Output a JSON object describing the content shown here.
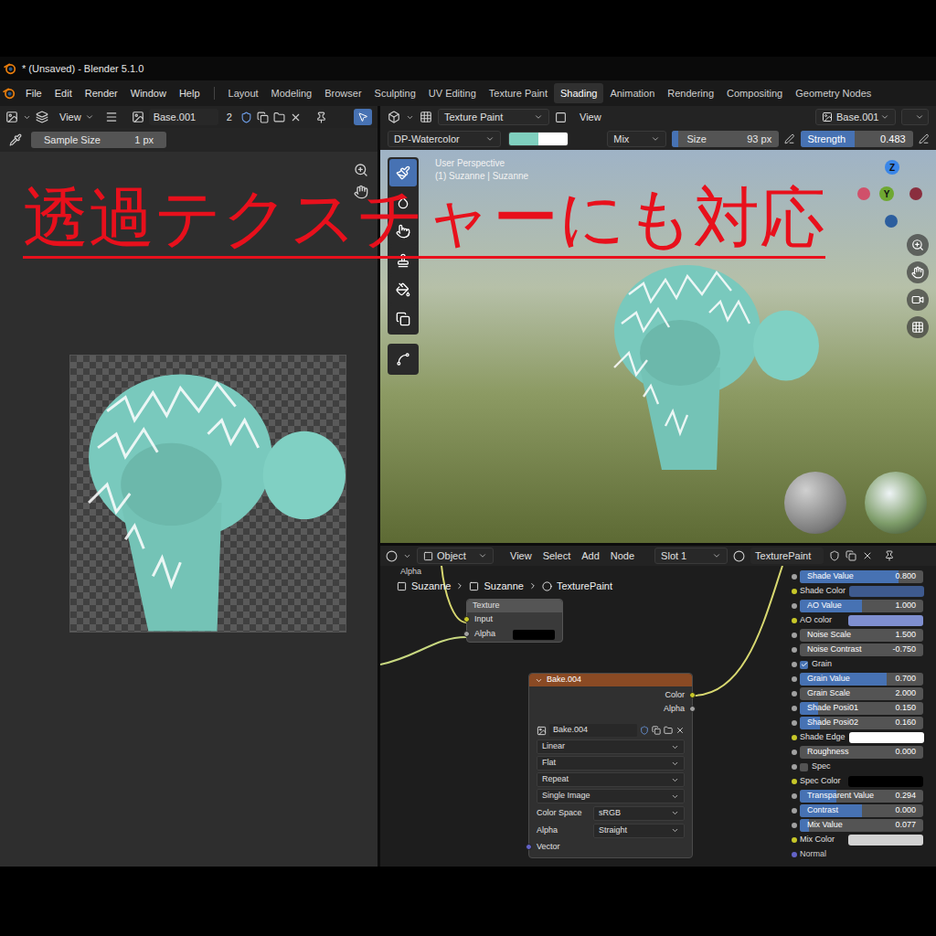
{
  "window": {
    "title": "* (Unsaved) - Blender 5.1.0"
  },
  "menus": [
    "File",
    "Edit",
    "Render",
    "Window",
    "Help"
  ],
  "workspaces": [
    {
      "label": "Layout",
      "selected": false
    },
    {
      "label": "Modeling",
      "selected": false
    },
    {
      "label": "Browser",
      "selected": false
    },
    {
      "label": "Sculpting",
      "selected": false
    },
    {
      "label": "UV Editing",
      "selected": false
    },
    {
      "label": "Texture Paint",
      "selected": false
    },
    {
      "label": "Shading",
      "selected": true
    },
    {
      "label": "Animation",
      "selected": false
    },
    {
      "label": "Rendering",
      "selected": false
    },
    {
      "label": "Compositing",
      "selected": false
    },
    {
      "label": "Geometry Nodes",
      "selected": false
    }
  ],
  "caption": "透過テクスチャーにも対応",
  "image_editor": {
    "view_menu": "View",
    "image_name": "Base.001",
    "users": "2",
    "sample_tool_active": true,
    "sample_size": {
      "label": "Sample Size",
      "value": "1 px"
    }
  },
  "viewport": {
    "mode": "Texture Paint",
    "view_menu": "View",
    "image_name": "Base.001",
    "brush": "DP-Watercolor",
    "primary_color": "#7fcfbe",
    "secondary_color": "#ffffff",
    "blend": "Mix",
    "size": {
      "label": "Size",
      "value": "93 px"
    },
    "strength": {
      "label": "Strength",
      "value": "0.483",
      "level": 0.483
    },
    "perspective": "User Perspective",
    "object_info": "(1) Suzanne | Suzanne",
    "tools": [
      {
        "selected": true
      },
      {
        "selected": false
      },
      {
        "selected": false
      },
      {
        "selected": false
      },
      {
        "selected": false
      },
      {
        "selected": false
      },
      {
        "selected": false
      }
    ],
    "gizmo": [
      {
        "label": "Z",
        "color": "#3a86e8"
      },
      {
        "label": "",
        "color": "#d0506a"
      },
      {
        "label": "Y",
        "color": "#6fa832"
      },
      {
        "label": "",
        "color": "#8a2e3e"
      },
      {
        "label": "",
        "color": "#2c5e9e"
      }
    ]
  },
  "node_editor": {
    "context": "Object",
    "menus": [
      "View",
      "Select",
      "Add",
      "Node"
    ],
    "slot": "Slot 1",
    "material": "TexturePaint",
    "breadcrumbs": [
      "Suzanne",
      "Suzanne",
      "TexturePaint"
    ],
    "edge_label": "Alpha",
    "partial_node": {
      "title": "Texture",
      "inputs": [
        {
          "label": "Input",
          "kind": "socket",
          "socket_color": "#c7c729",
          "color": "#000000"
        },
        {
          "label": "Alpha",
          "kind": "color",
          "socket_color": "#a1a1a1",
          "color": "#000000"
        }
      ]
    },
    "bake_node": {
      "title": "Bake.004",
      "outputs": [
        {
          "label": "Color",
          "socket_color": "#c7c729"
        },
        {
          "label": "Alpha",
          "socket_color": "#a1a1a1"
        }
      ],
      "image": "Bake.004",
      "options": [
        "Linear",
        "Flat",
        "Repeat",
        "Single Image"
      ],
      "fields": [
        {
          "label": "Color Space",
          "value": "sRGB"
        },
        {
          "label": "Alpha",
          "value": "Straight"
        }
      ],
      "input": {
        "label": "Vector",
        "socket_color": "#6363c7"
      }
    },
    "properties": [
      {
        "label": "Shade Value",
        "kind": "slider",
        "value": "0.800",
        "level": 0.8,
        "socket_color": "#a1a1a1"
      },
      {
        "label": "Shade Color",
        "kind": "color",
        "color": "#3e5a8e",
        "socket_color": "#c7c729"
      },
      {
        "label": "AO Value",
        "kind": "slider",
        "value": "1.000",
        "level": 0.5,
        "socket_color": "#a1a1a1"
      },
      {
        "label": "AO color",
        "kind": "color",
        "color": "#7f8fd0",
        "socket_color": "#c7c729"
      },
      {
        "label": "Noise Scale",
        "kind": "number",
        "value": "1.500",
        "socket_color": "#a1a1a1"
      },
      {
        "label": "Noise Contrast",
        "kind": "number",
        "value": "-0.750",
        "socket_color": "#a1a1a1"
      },
      {
        "label": "Grain",
        "kind": "checkbox",
        "checked": true,
        "socket_color": "#a1a1a1"
      },
      {
        "label": "Grain Value",
        "kind": "slider",
        "value": "0.700",
        "level": 0.7,
        "socket_color": "#a1a1a1"
      },
      {
        "label": "Grain Scale",
        "kind": "number",
        "value": "2.000",
        "socket_color": "#a1a1a1"
      },
      {
        "label": "Shade Posi01",
        "kind": "slider",
        "value": "0.150",
        "level": 0.15,
        "socket_color": "#a1a1a1"
      },
      {
        "label": "Shade Posi02",
        "kind": "slider",
        "value": "0.160",
        "level": 0.16,
        "socket_color": "#a1a1a1"
      },
      {
        "label": "Shade Edge",
        "kind": "color",
        "color": "#ffffff",
        "socket_color": "#c7c729"
      },
      {
        "label": "Roughness",
        "kind": "slider",
        "value": "0.000",
        "level": 0,
        "socket_color": "#a1a1a1"
      },
      {
        "label": "Spec",
        "kind": "checkbox",
        "checked": false,
        "socket_color": "#a1a1a1"
      },
      {
        "label": "Spec Color",
        "kind": "color",
        "color": "#000000",
        "socket_color": "#c7c729"
      },
      {
        "label": "Transparent Value",
        "kind": "slider",
        "value": "0.294",
        "level": 0.294,
        "socket_color": "#a1a1a1"
      },
      {
        "label": "Contrast",
        "kind": "slider",
        "value": "0.000",
        "level": 0.5,
        "socket_color": "#a1a1a1"
      },
      {
        "label": "Mix Value",
        "kind": "slider",
        "value": "0.077",
        "level": 0.077,
        "socket_color": "#a1a1a1"
      },
      {
        "label": "Mix Color",
        "kind": "color",
        "color": "#d2d2d2",
        "socket_color": "#c7c729"
      },
      {
        "label": "Normal",
        "kind": "vector",
        "socket_color": "#6363c7"
      }
    ]
  }
}
